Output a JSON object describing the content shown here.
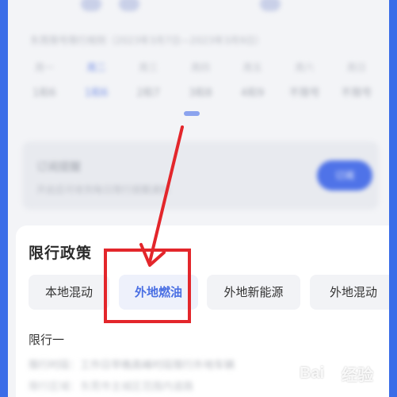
{
  "header": {
    "date_range": "东莞限号限行规则（2023年3月7日—2023年3月9日）"
  },
  "days": [
    {
      "weekday": "周一",
      "numbers": "1和6",
      "active": false
    },
    {
      "weekday": "周二",
      "numbers": "1和6",
      "active": true
    },
    {
      "weekday": "周三",
      "numbers": "2和7",
      "active": false
    },
    {
      "weekday": "周四",
      "numbers": "3和8",
      "active": false
    },
    {
      "weekday": "周五",
      "numbers": "4和9",
      "active": false
    },
    {
      "weekday": "周六",
      "numbers": "不限号",
      "active": false
    },
    {
      "weekday": "周日",
      "numbers": "不限号",
      "active": false
    }
  ],
  "reminder": {
    "title": "订阅提醒",
    "subtitle": "开启后可收到每日限行提醒通知",
    "button": "订阅"
  },
  "policy": {
    "title": "限行政策",
    "tabs": [
      "本地混动",
      "外地燃油",
      "外地新能源",
      "外地混动"
    ],
    "selected_tab": "外地燃油",
    "sub_label": "限行一",
    "sub_text": "限行时段：工作日早晚高峰时段限行外地车辆",
    "sub_text2": "限行区域：东莞市主城区范围内道路"
  },
  "annotation": {
    "highlight_color": "#e3262b",
    "arrow_color": "#e3262b"
  },
  "watermark": {
    "brand_left": "Bai",
    "brand_right": "经验"
  },
  "colors": {
    "accent": "#4a6fe3",
    "frame": "#3a6de8"
  }
}
